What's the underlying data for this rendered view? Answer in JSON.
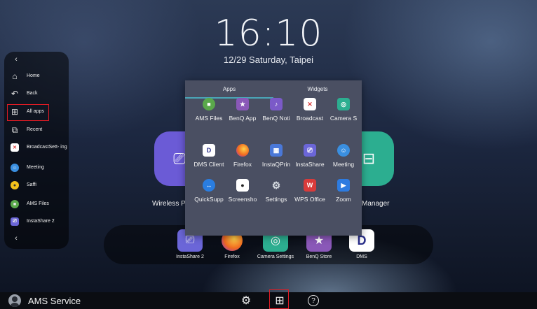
{
  "clock": {
    "time": "16:10",
    "date": "12/29  Saturday, Taipei"
  },
  "sidebar": {
    "items": [
      {
        "label": "Home",
        "icon": "home-icon"
      },
      {
        "label": "Back",
        "icon": "back-icon"
      },
      {
        "label": "All apps",
        "icon": "grid-icon"
      },
      {
        "label": "Recent",
        "icon": "recent-icon"
      },
      {
        "label": "BroadcastSett-\ning",
        "icon": "broadcast-app-icon",
        "color": "#ffffff"
      },
      {
        "label": "Meeting",
        "icon": "meeting-app-icon",
        "color": "#3a8fe0"
      },
      {
        "label": "Saffi",
        "icon": "saffi-app-icon",
        "color": "#f3c21b"
      },
      {
        "label": "AMS Files",
        "icon": "ams-files-app-icon",
        "color": "#5aa84b"
      },
      {
        "label": "InstaShare 2",
        "icon": "instashare-app-icon",
        "color": "#6b66d8"
      }
    ]
  },
  "popup": {
    "tabs": [
      {
        "label": "Apps"
      },
      {
        "label": "Widgets"
      }
    ],
    "apps": [
      {
        "label": "AMS Files",
        "icon": "ams-files-icon",
        "color": "#5aa84b"
      },
      {
        "label": "BenQ App",
        "icon": "benq-app-store-icon",
        "color": "#8a58b8"
      },
      {
        "label": "BenQ Noti",
        "icon": "benq-notification-icon",
        "color": "#7b5ac8"
      },
      {
        "label": "Broadcast",
        "icon": "broadcast-icon",
        "color": "#ffffff"
      },
      {
        "label": "Camera S",
        "icon": "camera-settings-icon",
        "color": "#2cae90"
      },
      {
        "label": "DMS Client",
        "icon": "dms-client-icon",
        "color": "#ffffff"
      },
      {
        "label": "Firefox",
        "icon": "firefox-icon",
        "color": "#f06b1f"
      },
      {
        "label": "InstaQPrin",
        "icon": "instaqprint-icon",
        "color": "#4a78d8"
      },
      {
        "label": "InstaShare",
        "icon": "instashare-icon",
        "color": "#6b66d8"
      },
      {
        "label": "Meeting",
        "icon": "meeting-icon",
        "color": "#3a8fe0"
      },
      {
        "label": "QuickSupp",
        "icon": "quicksupport-icon",
        "color": "#2a7de0"
      },
      {
        "label": "Screensho",
        "icon": "screenshot-icon",
        "color": "#ffffff"
      },
      {
        "label": "Settings",
        "icon": "settings-gear-icon",
        "color": "#2a8f7a"
      },
      {
        "label": "WPS Office",
        "icon": "wps-office-icon",
        "color": "#d93b3b"
      },
      {
        "label": "Zoom",
        "icon": "zoom-icon",
        "color": "#2d7be0"
      }
    ]
  },
  "background_labels": {
    "left": "Wireless P",
    "right": "Manager"
  },
  "dock": {
    "items": [
      {
        "label": "InstaShare 2",
        "icon": "instashare-dock-icon",
        "color": "#6b66d8"
      },
      {
        "label": "Firefox",
        "icon": "firefox-dock-icon",
        "color": "#f06b1f"
      },
      {
        "label": "Camera Settings",
        "icon": "camera-settings-dock-icon",
        "color": "#2cae90"
      },
      {
        "label": "BenQ Store",
        "icon": "benq-store-dock-icon",
        "color": "#8a58b8"
      },
      {
        "label": "DMS",
        "icon": "dms-dock-icon",
        "color": "#ffffff"
      }
    ]
  },
  "bottombar": {
    "user_name": "AMS Service",
    "icons": [
      "settings-icon",
      "all-apps-icon",
      "help-icon"
    ]
  },
  "colors": {
    "highlight_box": "#e01b24",
    "tab_accent": "#4aa6b8"
  }
}
